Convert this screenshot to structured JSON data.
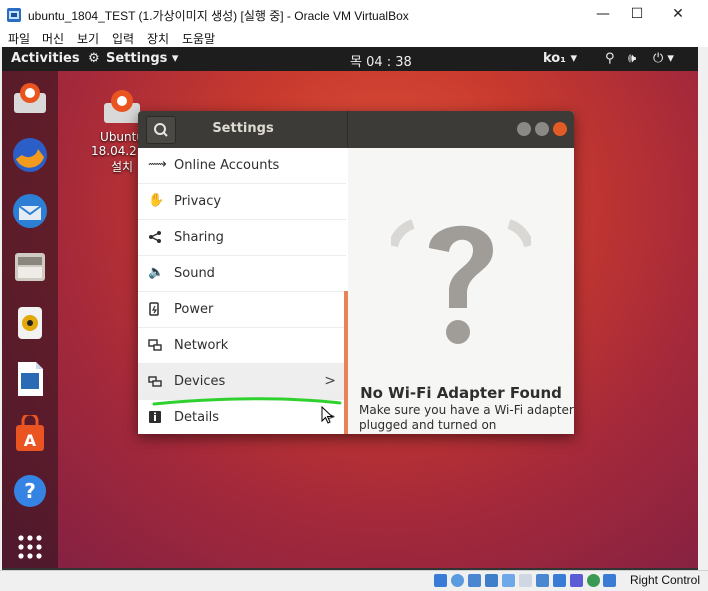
{
  "vbox": {
    "title": "ubuntu_1804_TEST (1.가상이미지 생성) [실행 중] - Oracle VM VirtualBox",
    "menu": [
      "파일",
      "머신",
      "보기",
      "입력",
      "장치",
      "도움말"
    ],
    "controls": {
      "minimize": "—",
      "maximize": "☐",
      "close": "✕"
    },
    "status": {
      "host_key": "Right Control"
    }
  },
  "topbar": {
    "activities": "Activities",
    "app_menu": "Settings ▾",
    "clock": "목 04 : 38",
    "input_method": "ko₁ ▾"
  },
  "desktop": {
    "icon_label_1": "Ubuntu",
    "icon_label_2": "18.04.2 LT",
    "icon_label_3": "설치"
  },
  "settings": {
    "title": "Settings",
    "sidebar": [
      {
        "label": "Online Accounts",
        "icon": "online-accounts-icon"
      },
      {
        "label": "Privacy",
        "icon": "privacy-icon"
      },
      {
        "label": "Sharing",
        "icon": "sharing-icon"
      },
      {
        "label": "Sound",
        "icon": "sound-icon"
      },
      {
        "label": "Power",
        "icon": "power-icon"
      },
      {
        "label": "Network",
        "icon": "network-icon"
      },
      {
        "label": "Devices",
        "icon": "devices-icon",
        "arrow": ">"
      },
      {
        "label": "Details",
        "icon": "details-icon",
        "arrow": ">"
      }
    ],
    "content": {
      "placeholder_title": "No Wi-Fi Adapter Found",
      "placeholder_sub": "Make sure you have a Wi-Fi adapter plugged and turned on"
    }
  },
  "colors": {
    "accent": "#e95420",
    "header": "#3c3b37",
    "close": "#e35b24"
  }
}
